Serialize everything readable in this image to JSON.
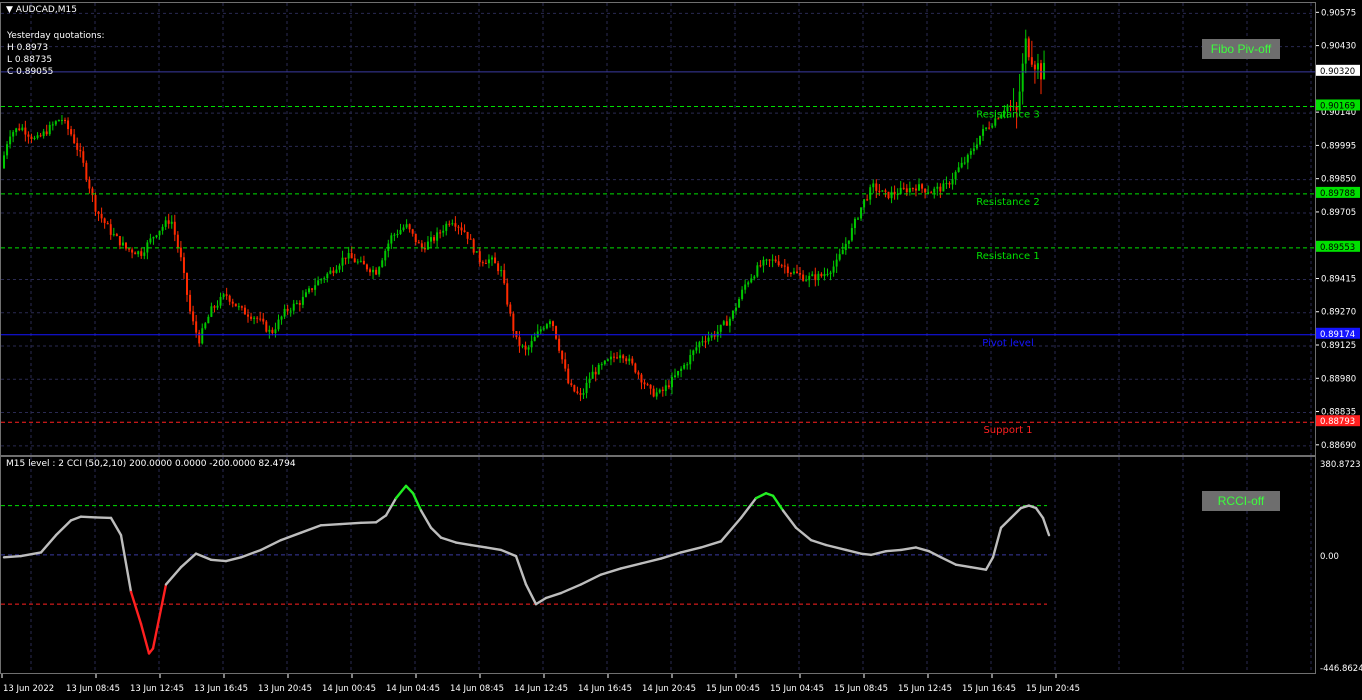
{
  "symbol_title": "AUDCAD,M15",
  "yesterday": {
    "heading": "Yesterday quotations:",
    "high": "H 0.8973",
    "low": "L 0.88735",
    "close": "C 0.89055"
  },
  "buttons": {
    "fibo": "Fibo Piv-off",
    "rcci": "RCCI-off"
  },
  "indicator_title": "M15 level : 2 CCI (50,2,10) 200.0000 0.0000 -200.0000 82.4794",
  "colors": {
    "bull": "#00c800",
    "bear": "#ff2a00",
    "resistance": "#00e000",
    "pivot": "#1414ff",
    "support": "#ff2020",
    "cci": "#bdbdbd",
    "grid": "#2a2a52"
  },
  "price_axis": {
    "ticks": [
      "0.90575",
      "0.90430",
      "0.90140",
      "0.89995",
      "0.89850",
      "0.89705",
      "0.89415",
      "0.89270",
      "0.89125",
      "0.88980",
      "0.88835",
      "0.88690"
    ],
    "current_price": "0.90320"
  },
  "levels": [
    {
      "label": "Resistance 3",
      "value": "0.90169",
      "kind": "resistance"
    },
    {
      "label": "Resistance 2",
      "value": "0.89788",
      "kind": "resistance"
    },
    {
      "label": "Resistance 1",
      "value": "0.89553",
      "kind": "resistance"
    },
    {
      "label": "Pivot level",
      "value": "0.89174",
      "kind": "pivot"
    },
    {
      "label": "Support 1",
      "value": "0.88793",
      "kind": "support"
    }
  ],
  "cci_axis": {
    "top": "380.8723",
    "zero": "0.00",
    "bottom": "-446.8624"
  },
  "time_axis": [
    "13 Jun 2022",
    "13 Jun 08:45",
    "13 Jun 12:45",
    "13 Jun 16:45",
    "13 Jun 20:45",
    "14 Jun 00:45",
    "14 Jun 04:45",
    "14 Jun 08:45",
    "14 Jun 12:45",
    "14 Jun 16:45",
    "14 Jun 20:45",
    "15 Jun 00:45",
    "15 Jun 04:45",
    "15 Jun 08:45",
    "15 Jun 12:45",
    "15 Jun 16:45",
    "15 Jun 20:45"
  ],
  "chart_data": {
    "type": "candlestick",
    "symbol": "AUDCAD",
    "timeframe": "M15",
    "ylim": [
      0.8865,
      0.9062
    ],
    "close_path": [
      [
        0,
        0.899
      ],
      [
        8,
        0.9005
      ],
      [
        20,
        0.9008
      ],
      [
        35,
        0.9002
      ],
      [
        50,
        0.9008
      ],
      [
        60,
        0.9012
      ],
      [
        70,
        0.9005
      ],
      [
        80,
        0.8995
      ],
      [
        95,
        0.8972
      ],
      [
        110,
        0.8962
      ],
      [
        125,
        0.8955
      ],
      [
        140,
        0.8953
      ],
      [
        155,
        0.8962
      ],
      [
        170,
        0.8968
      ],
      [
        180,
        0.895
      ],
      [
        190,
        0.8925
      ],
      [
        198,
        0.8915
      ],
      [
        210,
        0.8928
      ],
      [
        225,
        0.8935
      ],
      [
        240,
        0.8928
      ],
      [
        255,
        0.8925
      ],
      [
        270,
        0.8918
      ],
      [
        285,
        0.8928
      ],
      [
        300,
        0.8932
      ],
      [
        315,
        0.894
      ],
      [
        330,
        0.8945
      ],
      [
        345,
        0.8952
      ],
      [
        360,
        0.8948
      ],
      [
        375,
        0.8945
      ],
      [
        390,
        0.896
      ],
      [
        405,
        0.8965
      ],
      [
        420,
        0.8955
      ],
      [
        435,
        0.896
      ],
      [
        450,
        0.8968
      ],
      [
        465,
        0.8962
      ],
      [
        478,
        0.895
      ],
      [
        490,
        0.895
      ],
      [
        500,
        0.8945
      ],
      [
        508,
        0.8928
      ],
      [
        515,
        0.8915
      ],
      [
        525,
        0.891
      ],
      [
        540,
        0.892
      ],
      [
        550,
        0.8925
      ],
      [
        558,
        0.8912
      ],
      [
        568,
        0.8895
      ],
      [
        580,
        0.889
      ],
      [
        590,
        0.89
      ],
      [
        605,
        0.8905
      ],
      [
        620,
        0.891
      ],
      [
        635,
        0.8902
      ],
      [
        650,
        0.8892
      ],
      [
        660,
        0.8892
      ],
      [
        672,
        0.8898
      ],
      [
        685,
        0.8905
      ],
      [
        700,
        0.8915
      ],
      [
        715,
        0.8918
      ],
      [
        730,
        0.8925
      ],
      [
        745,
        0.894
      ],
      [
        760,
        0.8948
      ],
      [
        775,
        0.895
      ],
      [
        790,
        0.8945
      ],
      [
        805,
        0.8942
      ],
      [
        820,
        0.8943
      ],
      [
        835,
        0.8948
      ],
      [
        850,
        0.8962
      ],
      [
        862,
        0.8975
      ],
      [
        872,
        0.8982
      ],
      [
        885,
        0.8978
      ],
      [
        900,
        0.898
      ],
      [
        915,
        0.8982
      ],
      [
        930,
        0.898
      ],
      [
        945,
        0.8982
      ],
      [
        958,
        0.899
      ],
      [
        968,
        0.8995
      ],
      [
        980,
        0.9005
      ],
      [
        995,
        0.9012
      ],
      [
        1008,
        0.9018
      ],
      [
        1015,
        0.9012
      ],
      [
        1020,
        0.9028
      ],
      [
        1025,
        0.9045
      ],
      [
        1032,
        0.9038
      ],
      [
        1040,
        0.9032
      ],
      [
        1046,
        0.9032
      ]
    ],
    "cci_ylim": [
      -446.8624,
      380.8723
    ],
    "cci_path": [
      [
        3,
        -10
      ],
      [
        20,
        -5
      ],
      [
        40,
        10
      ],
      [
        55,
        80
      ],
      [
        70,
        140
      ],
      [
        80,
        155
      ],
      [
        95,
        152
      ],
      [
        110,
        150
      ],
      [
        120,
        80
      ],
      [
        130,
        -150
      ],
      [
        140,
        -280
      ],
      [
        148,
        -400
      ],
      [
        152,
        -380
      ],
      [
        165,
        -120
      ],
      [
        180,
        -50
      ],
      [
        195,
        5
      ],
      [
        210,
        -20
      ],
      [
        225,
        -25
      ],
      [
        240,
        -10
      ],
      [
        260,
        20
      ],
      [
        280,
        60
      ],
      [
        300,
        90
      ],
      [
        320,
        120
      ],
      [
        340,
        125
      ],
      [
        360,
        130
      ],
      [
        375,
        132
      ],
      [
        385,
        160
      ],
      [
        395,
        230
      ],
      [
        405,
        280
      ],
      [
        412,
        250
      ],
      [
        420,
        180
      ],
      [
        430,
        110
      ],
      [
        440,
        70
      ],
      [
        455,
        50
      ],
      [
        470,
        40
      ],
      [
        485,
        30
      ],
      [
        500,
        20
      ],
      [
        515,
        -5
      ],
      [
        525,
        -120
      ],
      [
        535,
        -200
      ],
      [
        545,
        -175
      ],
      [
        560,
        -155
      ],
      [
        580,
        -120
      ],
      [
        600,
        -80
      ],
      [
        620,
        -55
      ],
      [
        640,
        -35
      ],
      [
        660,
        -15
      ],
      [
        680,
        10
      ],
      [
        700,
        30
      ],
      [
        720,
        55
      ],
      [
        740,
        150
      ],
      [
        755,
        230
      ],
      [
        765,
        250
      ],
      [
        772,
        240
      ],
      [
        782,
        180
      ],
      [
        795,
        110
      ],
      [
        810,
        60
      ],
      [
        825,
        40
      ],
      [
        845,
        20
      ],
      [
        860,
        5
      ],
      [
        870,
        0
      ],
      [
        885,
        15
      ],
      [
        900,
        20
      ],
      [
        915,
        30
      ],
      [
        928,
        15
      ],
      [
        940,
        -10
      ],
      [
        955,
        -40
      ],
      [
        970,
        -50
      ],
      [
        985,
        -60
      ],
      [
        992,
        -10
      ],
      [
        1000,
        110
      ],
      [
        1010,
        150
      ],
      [
        1020,
        190
      ],
      [
        1028,
        200
      ],
      [
        1035,
        190
      ],
      [
        1042,
        150
      ],
      [
        1048,
        80
      ]
    ],
    "cci_levels": [
      200,
      0,
      -200
    ]
  }
}
